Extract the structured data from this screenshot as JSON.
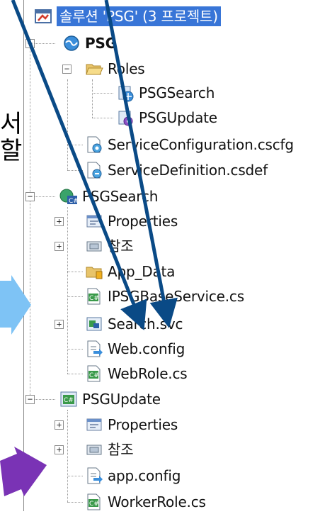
{
  "solution": {
    "label": "솔루션 'PSG' (3 프로젝트)"
  },
  "psg": {
    "label": "PSG",
    "roles": {
      "label": "Roles",
      "items": [
        "PSGSearch",
        "PSGUpdate"
      ]
    },
    "files": [
      "ServiceConfiguration.cscfg",
      "ServiceDefinition.csdef"
    ]
  },
  "psgsearch": {
    "label": "PSGSearch",
    "items": [
      "Properties",
      "참조",
      "App_Data",
      "IPSGBaseService.cs",
      "Search.svc",
      "Web.config",
      "WebRole.cs"
    ]
  },
  "psgupdate": {
    "label": "PSGUpdate",
    "items": [
      "Properties",
      "참조",
      "app.config",
      "WorkerRole.cs"
    ]
  },
  "side_text": [
    "서",
    "할"
  ],
  "colors": {
    "selection": "#3875d7",
    "dark_arrow": "#0a4a86",
    "light_arrow": "#7ec3f5",
    "purple_arrow": "#7a33b5"
  }
}
